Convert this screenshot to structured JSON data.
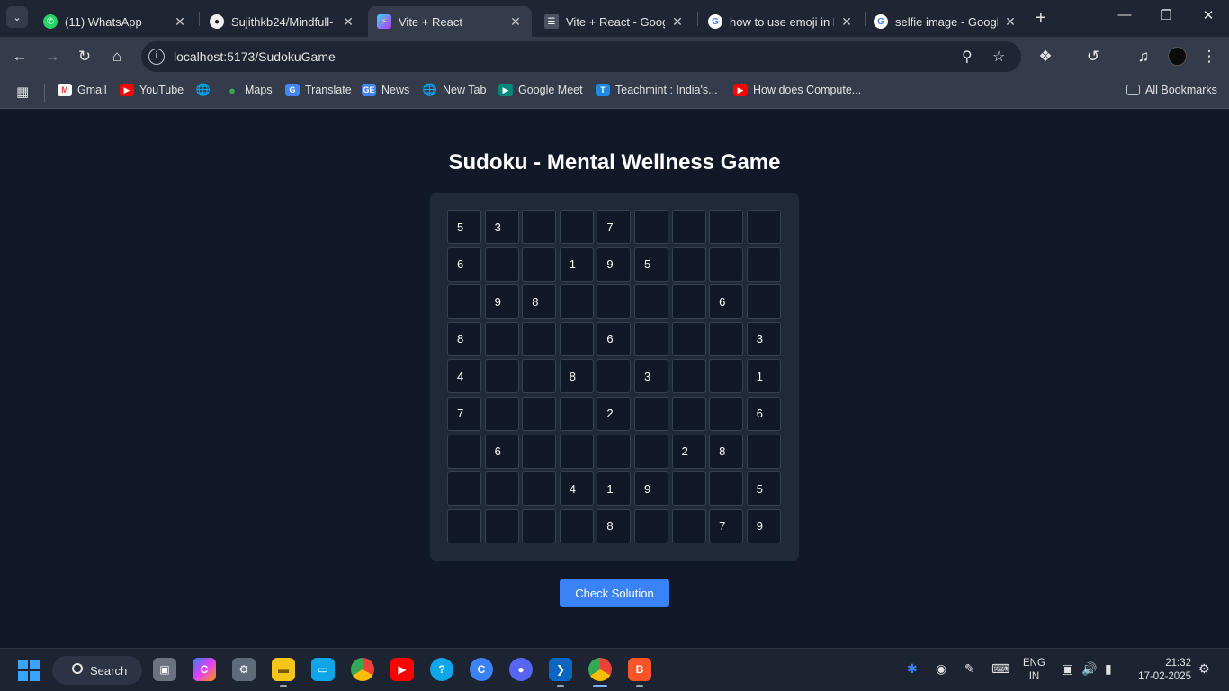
{
  "browser": {
    "tabs": [
      {
        "title": "(11) WhatsApp",
        "icon": "whatsapp-icon",
        "active": false
      },
      {
        "title": "Sujithkb24/Mindfull-",
        "icon": "github-icon",
        "active": false
      },
      {
        "title": "Vite + React",
        "icon": "vite-icon",
        "active": true
      },
      {
        "title": "Vite + React - Google",
        "icon": "google-docs-icon",
        "active": false
      },
      {
        "title": "how to use emoji in l",
        "icon": "google-icon",
        "active": false
      },
      {
        "title": "selfie image - Google",
        "icon": "google-icon",
        "active": false
      }
    ],
    "address": "localhost:5173/SudokuGame",
    "bookmarks": [
      {
        "label": "Gmail",
        "icon": "gmail-icon"
      },
      {
        "label": "YouTube",
        "icon": "youtube-icon"
      },
      {
        "label": "",
        "icon": "globe-icon"
      },
      {
        "label": "Maps",
        "icon": "maps-icon"
      },
      {
        "label": "Translate",
        "icon": "translate-icon"
      },
      {
        "label": "News",
        "icon": "news-icon"
      },
      {
        "label": "New Tab",
        "icon": "globe-icon"
      },
      {
        "label": "Google Meet",
        "icon": "meet-icon"
      },
      {
        "label": "Teachmint : India's...",
        "icon": "teachmint-icon"
      },
      {
        "label": "How does Compute...",
        "icon": "youtube-icon"
      }
    ],
    "all_bookmarks": "All Bookmarks"
  },
  "page": {
    "title": "Sudoku - Mental Wellness Game",
    "board": [
      [
        "5",
        "3",
        "",
        "",
        "7",
        "",
        "",
        "",
        ""
      ],
      [
        "6",
        "",
        "",
        "1",
        "9",
        "5",
        "",
        "",
        ""
      ],
      [
        "",
        "9",
        "8",
        "",
        "",
        "",
        "",
        "6",
        ""
      ],
      [
        "8",
        "",
        "",
        "",
        "6",
        "",
        "",
        "",
        "3"
      ],
      [
        "4",
        "",
        "",
        "8",
        "",
        "3",
        "",
        "",
        "1"
      ],
      [
        "7",
        "",
        "",
        "",
        "2",
        "",
        "",
        "",
        "6"
      ],
      [
        "",
        "6",
        "",
        "",
        "",
        "",
        "2",
        "8",
        ""
      ],
      [
        "",
        "",
        "",
        "4",
        "1",
        "9",
        "",
        "",
        "5"
      ],
      [
        "",
        "",
        "",
        "",
        "8",
        "",
        "",
        "7",
        "9"
      ]
    ],
    "check_button": "Check Solution"
  },
  "taskbar": {
    "search_label": "Search",
    "lang_top": "ENG",
    "lang_bottom": "IN",
    "time": "21:32",
    "date": "17-02-2025"
  },
  "colors": {
    "page_bg": "#111827",
    "board_bg": "#1f2937",
    "button": "#3b82f6"
  }
}
